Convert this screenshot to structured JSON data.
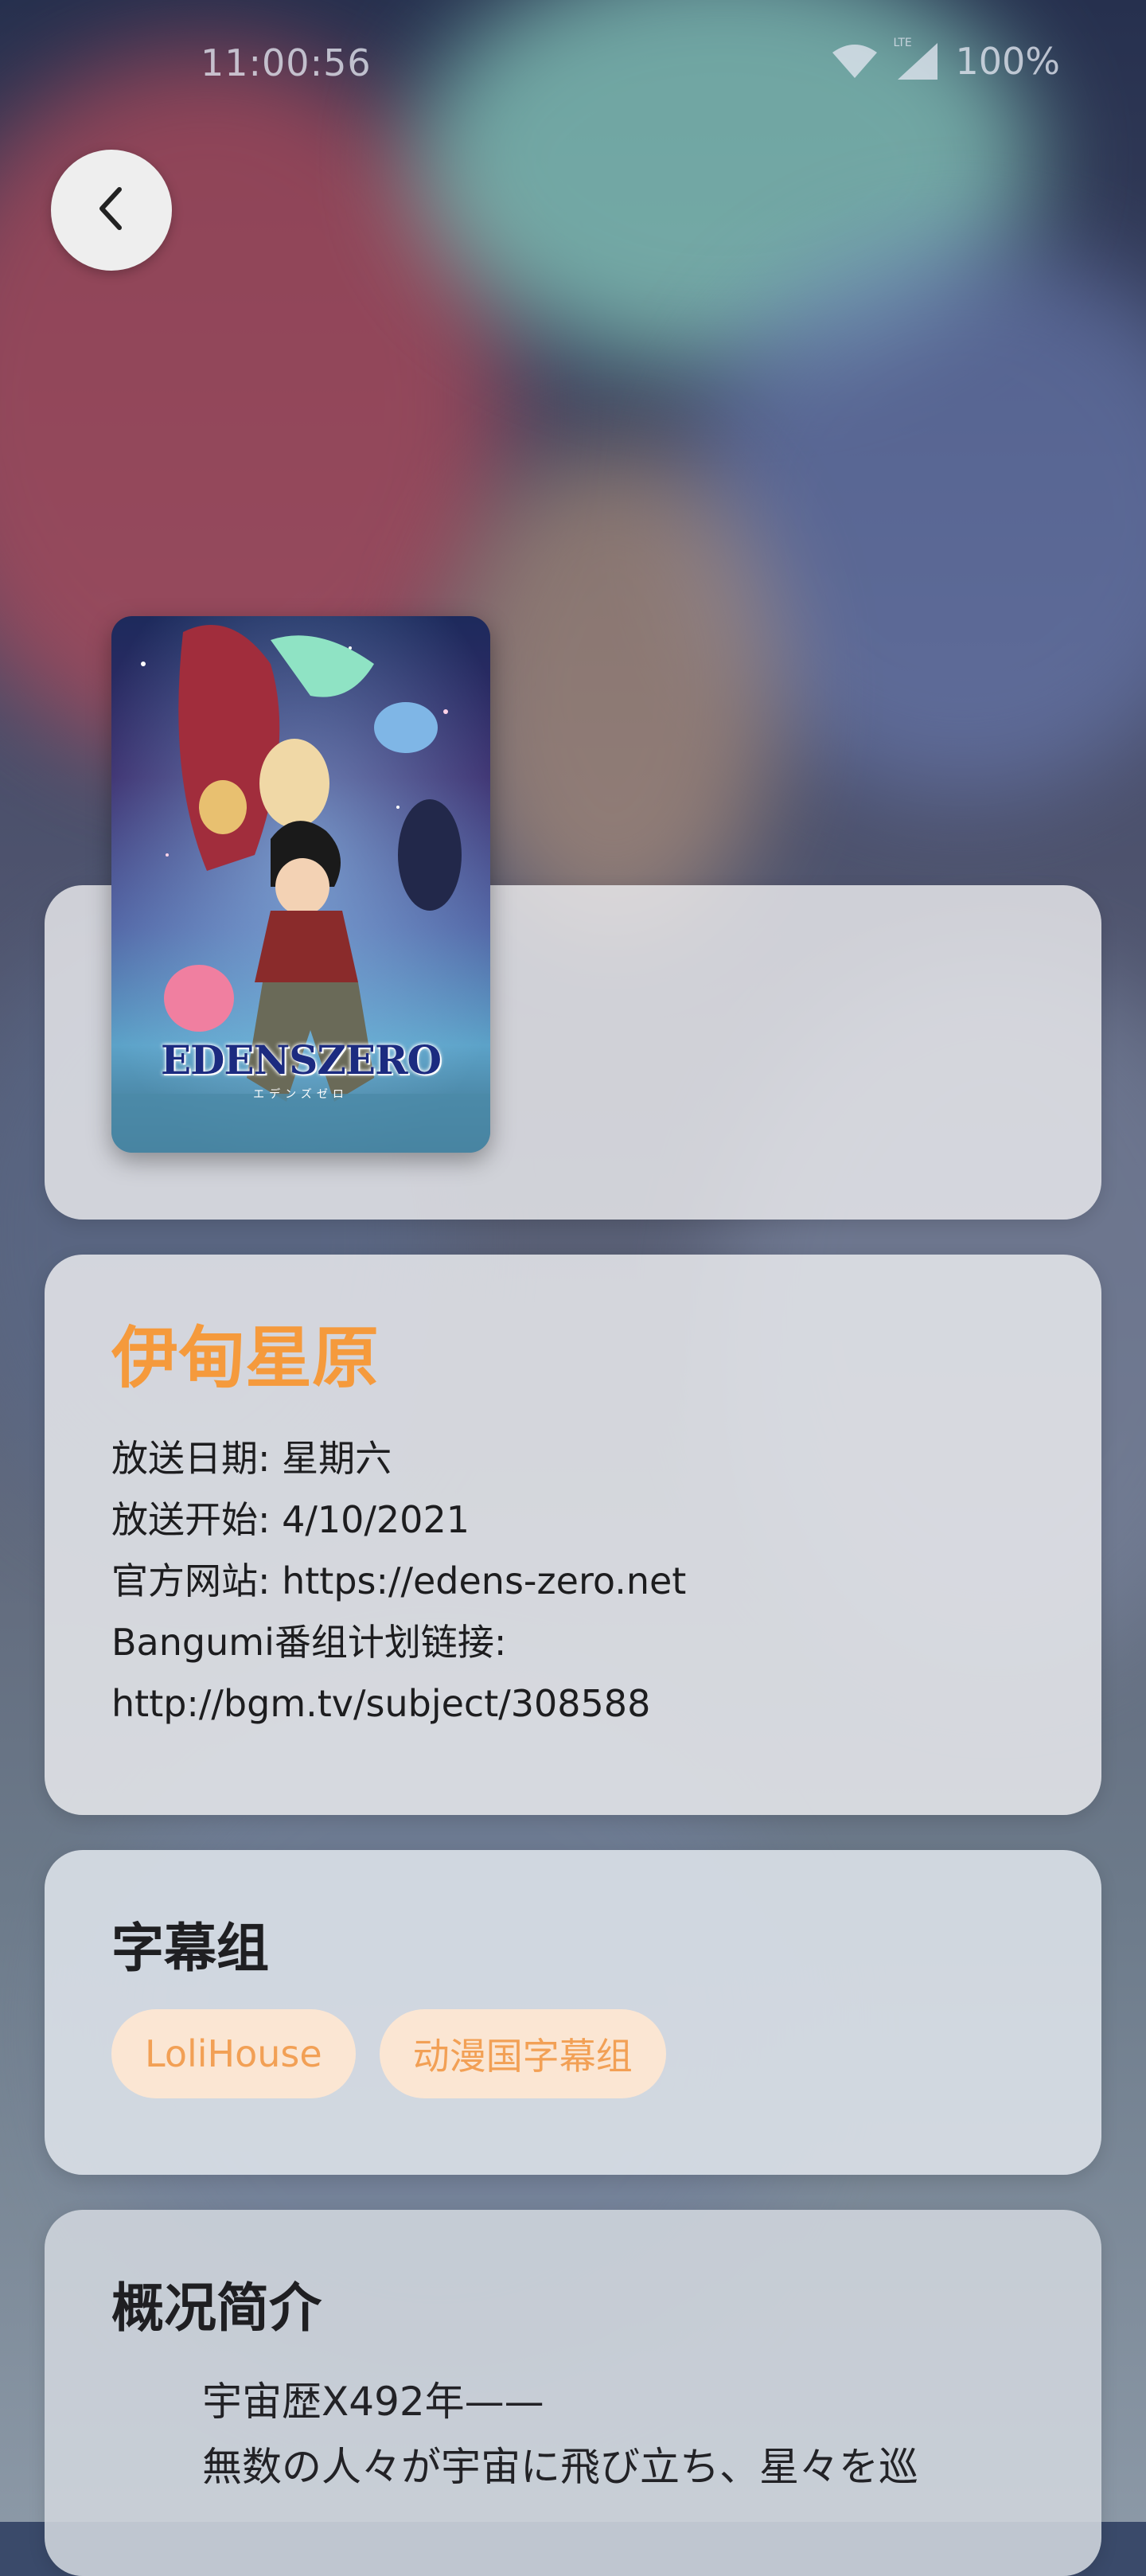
{
  "status_bar": {
    "time": "11:00:56",
    "network": "LTE",
    "battery": "100%"
  },
  "poster": {
    "logo_text": "EDENSZERO",
    "logo_sub": "エデンズゼロ"
  },
  "info": {
    "title": "伊甸星原",
    "lines": [
      "放送日期: 星期六",
      "放送开始: 4/10/2021",
      "官方网站: https://edens-zero.net",
      "Bangumi番组计划链接:",
      "http://bgm.tv/subject/308588"
    ]
  },
  "fansub": {
    "heading": "字幕组",
    "groups": [
      "LoliHouse",
      "动漫国字幕组"
    ]
  },
  "summary": {
    "heading": "概况简介",
    "lines": [
      "宇宙歴X492年——",
      "無数の人々が宇宙に飛び立ち、星々を巡"
    ]
  },
  "colors": {
    "title_accent": "#f59a3c",
    "chip_bg": "#fbe6d3",
    "chip_text": "#f2a055"
  }
}
